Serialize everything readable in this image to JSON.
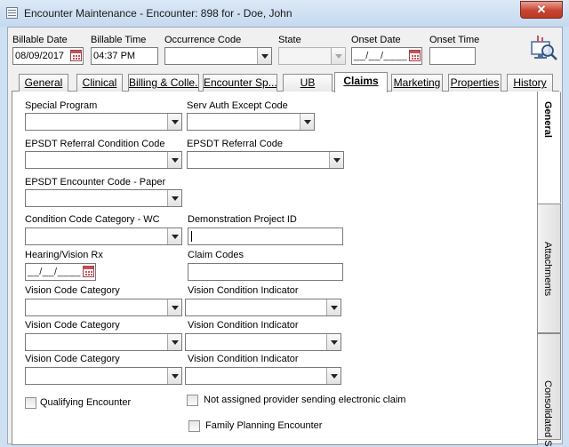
{
  "window": {
    "title": "Encounter Maintenance - Encounter: 898 for - Doe, John",
    "close_label": "✕"
  },
  "header": {
    "billable_date_label": "Billable Date",
    "billable_date_value": "08/09/2017",
    "billable_time_label": "Billable Time",
    "billable_time_value": "04:37 PM",
    "occurrence_code_label": "Occurrence Code",
    "occurrence_code_value": "",
    "state_label": "State",
    "state_value": "",
    "onset_date_label": "Onset Date",
    "onset_date_value": "__/__/____",
    "onset_time_label": "Onset Time",
    "onset_time_value": ""
  },
  "tabs": [
    {
      "label": "General"
    },
    {
      "label": "Clinical"
    },
    {
      "label": "Billing & Colle..."
    },
    {
      "label": "Encounter  Sp..."
    },
    {
      "label": "UB"
    },
    {
      "label": "Claims"
    },
    {
      "label": "Marketing"
    },
    {
      "label": "Properties"
    },
    {
      "label": "History"
    }
  ],
  "side_tabs": [
    {
      "label": "General"
    },
    {
      "label": "Attachments"
    },
    {
      "label": "Consolidated S"
    }
  ],
  "form": {
    "special_program_label": "Special Program",
    "serv_auth_label": "Serv Auth Except Code",
    "epsdt_ref_cond_label": "EPSDT Referral Condition Code",
    "epsdt_ref_code_label": "EPSDT Referral Code",
    "epsdt_enc_label": "EPSDT Encounter Code - Paper",
    "cond_cat_label": "Condition Code Category - WC",
    "demo_project_label": "Demonstration Project ID",
    "hearing_label": "Hearing/Vision Rx",
    "hearing_value": "__/__/____",
    "claim_codes_label": "Claim Codes",
    "vision_cat_label_1": "Vision Code Category",
    "vision_ind_label_1": "Vision Condition Indicator",
    "vision_cat_label_2": "Vision Code Category",
    "vision_ind_label_2": "Vision Condition Indicator",
    "vision_cat_label_3": "Vision Code Category",
    "vision_ind_label_3": "Vision Condition Indicator",
    "qualifying_label": "Qualifying Encounter",
    "not_assigned_label": "Not assigned provider sending electronic claim",
    "family_planning_label": "Family Planning Encounter"
  },
  "colors": {
    "title_bar": "#c6d9ef",
    "close_button": "#c7432f"
  }
}
